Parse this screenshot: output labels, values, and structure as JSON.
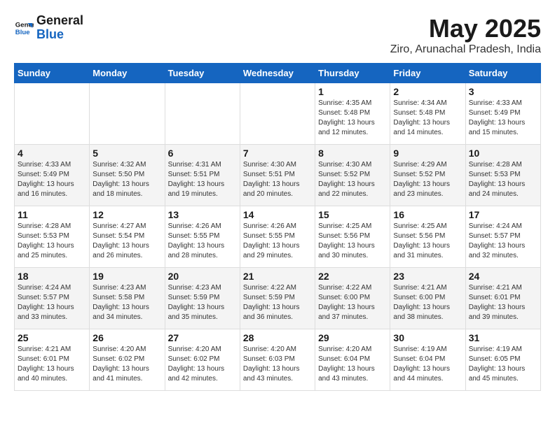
{
  "header": {
    "logo_line1": "General",
    "logo_line2": "Blue",
    "title": "May 2025",
    "subtitle": "Ziro, Arunachal Pradesh, India"
  },
  "calendar": {
    "days_of_week": [
      "Sunday",
      "Monday",
      "Tuesday",
      "Wednesday",
      "Thursday",
      "Friday",
      "Saturday"
    ],
    "weeks": [
      [
        {
          "day": "",
          "info": ""
        },
        {
          "day": "",
          "info": ""
        },
        {
          "day": "",
          "info": ""
        },
        {
          "day": "",
          "info": ""
        },
        {
          "day": "1",
          "info": "Sunrise: 4:35 AM\nSunset: 5:48 PM\nDaylight: 13 hours\nand 12 minutes."
        },
        {
          "day": "2",
          "info": "Sunrise: 4:34 AM\nSunset: 5:48 PM\nDaylight: 13 hours\nand 14 minutes."
        },
        {
          "day": "3",
          "info": "Sunrise: 4:33 AM\nSunset: 5:49 PM\nDaylight: 13 hours\nand 15 minutes."
        }
      ],
      [
        {
          "day": "4",
          "info": "Sunrise: 4:33 AM\nSunset: 5:49 PM\nDaylight: 13 hours\nand 16 minutes."
        },
        {
          "day": "5",
          "info": "Sunrise: 4:32 AM\nSunset: 5:50 PM\nDaylight: 13 hours\nand 18 minutes."
        },
        {
          "day": "6",
          "info": "Sunrise: 4:31 AM\nSunset: 5:51 PM\nDaylight: 13 hours\nand 19 minutes."
        },
        {
          "day": "7",
          "info": "Sunrise: 4:30 AM\nSunset: 5:51 PM\nDaylight: 13 hours\nand 20 minutes."
        },
        {
          "day": "8",
          "info": "Sunrise: 4:30 AM\nSunset: 5:52 PM\nDaylight: 13 hours\nand 22 minutes."
        },
        {
          "day": "9",
          "info": "Sunrise: 4:29 AM\nSunset: 5:52 PM\nDaylight: 13 hours\nand 23 minutes."
        },
        {
          "day": "10",
          "info": "Sunrise: 4:28 AM\nSunset: 5:53 PM\nDaylight: 13 hours\nand 24 minutes."
        }
      ],
      [
        {
          "day": "11",
          "info": "Sunrise: 4:28 AM\nSunset: 5:53 PM\nDaylight: 13 hours\nand 25 minutes."
        },
        {
          "day": "12",
          "info": "Sunrise: 4:27 AM\nSunset: 5:54 PM\nDaylight: 13 hours\nand 26 minutes."
        },
        {
          "day": "13",
          "info": "Sunrise: 4:26 AM\nSunset: 5:55 PM\nDaylight: 13 hours\nand 28 minutes."
        },
        {
          "day": "14",
          "info": "Sunrise: 4:26 AM\nSunset: 5:55 PM\nDaylight: 13 hours\nand 29 minutes."
        },
        {
          "day": "15",
          "info": "Sunrise: 4:25 AM\nSunset: 5:56 PM\nDaylight: 13 hours\nand 30 minutes."
        },
        {
          "day": "16",
          "info": "Sunrise: 4:25 AM\nSunset: 5:56 PM\nDaylight: 13 hours\nand 31 minutes."
        },
        {
          "day": "17",
          "info": "Sunrise: 4:24 AM\nSunset: 5:57 PM\nDaylight: 13 hours\nand 32 minutes."
        }
      ],
      [
        {
          "day": "18",
          "info": "Sunrise: 4:24 AM\nSunset: 5:57 PM\nDaylight: 13 hours\nand 33 minutes."
        },
        {
          "day": "19",
          "info": "Sunrise: 4:23 AM\nSunset: 5:58 PM\nDaylight: 13 hours\nand 34 minutes."
        },
        {
          "day": "20",
          "info": "Sunrise: 4:23 AM\nSunset: 5:59 PM\nDaylight: 13 hours\nand 35 minutes."
        },
        {
          "day": "21",
          "info": "Sunrise: 4:22 AM\nSunset: 5:59 PM\nDaylight: 13 hours\nand 36 minutes."
        },
        {
          "day": "22",
          "info": "Sunrise: 4:22 AM\nSunset: 6:00 PM\nDaylight: 13 hours\nand 37 minutes."
        },
        {
          "day": "23",
          "info": "Sunrise: 4:21 AM\nSunset: 6:00 PM\nDaylight: 13 hours\nand 38 minutes."
        },
        {
          "day": "24",
          "info": "Sunrise: 4:21 AM\nSunset: 6:01 PM\nDaylight: 13 hours\nand 39 minutes."
        }
      ],
      [
        {
          "day": "25",
          "info": "Sunrise: 4:21 AM\nSunset: 6:01 PM\nDaylight: 13 hours\nand 40 minutes."
        },
        {
          "day": "26",
          "info": "Sunrise: 4:20 AM\nSunset: 6:02 PM\nDaylight: 13 hours\nand 41 minutes."
        },
        {
          "day": "27",
          "info": "Sunrise: 4:20 AM\nSunset: 6:02 PM\nDaylight: 13 hours\nand 42 minutes."
        },
        {
          "day": "28",
          "info": "Sunrise: 4:20 AM\nSunset: 6:03 PM\nDaylight: 13 hours\nand 43 minutes."
        },
        {
          "day": "29",
          "info": "Sunrise: 4:20 AM\nSunset: 6:04 PM\nDaylight: 13 hours\nand 43 minutes."
        },
        {
          "day": "30",
          "info": "Sunrise: 4:19 AM\nSunset: 6:04 PM\nDaylight: 13 hours\nand 44 minutes."
        },
        {
          "day": "31",
          "info": "Sunrise: 4:19 AM\nSunset: 6:05 PM\nDaylight: 13 hours\nand 45 minutes."
        }
      ]
    ]
  }
}
